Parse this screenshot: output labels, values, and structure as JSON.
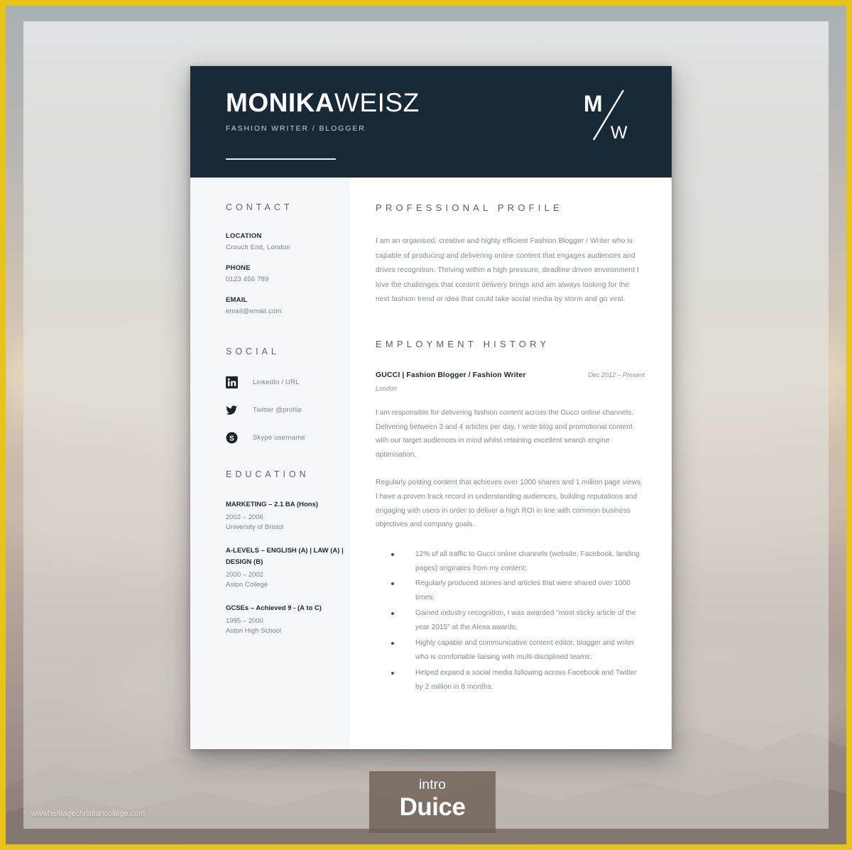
{
  "frame": {
    "border_color": "#e8c31a",
    "watermark": "wwwheritagechristiancollege.com"
  },
  "resume": {
    "header": {
      "name_first": "MONIKA",
      "name_last": "WEISZ",
      "job_title": "FASHION WRITER / BLOGGER",
      "monogram_primary": "M",
      "monogram_secondary": "W",
      "background_color": "#182a38"
    },
    "sidebar": {
      "contact": {
        "heading": "CONTACT",
        "items": [
          {
            "label": "LOCATION",
            "value": "Crouch End, London"
          },
          {
            "label": "PHONE",
            "value": "0123 456 789"
          },
          {
            "label": "EMAIL",
            "value": "email@email.com"
          }
        ]
      },
      "social": {
        "heading": "SOCIAL",
        "items": [
          {
            "icon": "linkedin-icon",
            "text": "LinkedIn / URL"
          },
          {
            "icon": "twitter-icon",
            "text": "Twitter @profile"
          },
          {
            "icon": "skype-icon",
            "text": "Skype username"
          }
        ]
      },
      "education": {
        "heading": "EDUCATION",
        "items": [
          {
            "degree": "MARKETING – 2.1 BA (Hons)",
            "years": "2002 – 2006",
            "school": "University of Bristol"
          },
          {
            "degree": "A-LEVELS – ENGLISH (A) | LAW (A) | DESIGN (B)",
            "years": "2000 – 2002",
            "school": "Aston College"
          },
          {
            "degree": "GCSEs – Achieved 9 - (A to C)",
            "years": "1995 – 2000",
            "school": "Aston High School"
          }
        ]
      }
    },
    "main": {
      "profile": {
        "heading": "PROFESSIONAL PROFILE",
        "text": "I am an organised, creative and highly efficient Fashion Blogger / Writer who is capable of producing and delivering online content that engages audiences and drives recognition.  Thriving within a high pressure, deadline driven environment I love the challenges that content delivery brings and am always looking for the next fashion trend or idea that could take social media by storm and go viral."
      },
      "employment": {
        "heading": "EMPLOYMENT HISTORY",
        "jobs": [
          {
            "title": "GUCCI | Fashion Blogger / Fashion Writer",
            "dates": "Dec 2012 – Present",
            "location": "London",
            "paragraphs": [
              "I am responsible for delivering fashion content across the Gucci online channels. Delivering between 3 and 4 articles per day, I write blog and promotional content with our target audiences in mind whilst retaining excellent search engine optimisation.",
              "Regularly posting content that achieves over 1000 shares and 1 million page views, I have a proven track record in understanding audiences, building reputations and engaging with users in order to deliver a high ROI in line with common business objectives and company goals."
            ],
            "bullets": [
              "12% of all traffic to Gucci online channels (website, Facebook, landing pages) originates from my content;",
              "Regularly produced stories and articles that were shared over 1000 times;",
              "Gained industry recognition, I was awarded \"most sticky article of the year 2015\"  at the Alexa awards;",
              "Highly capable and communicative content editor, blogger and writer  who is comfortable liaising with multi-disciplined teams;",
              "Helped expand a social media following across Facebook and Twitter by 2 million in 8 months."
            ]
          }
        ]
      }
    }
  },
  "badge": {
    "intro": "intro",
    "name": "Duice"
  }
}
